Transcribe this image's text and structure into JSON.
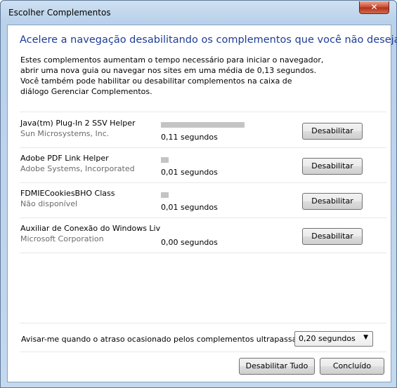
{
  "window": {
    "title": "Escolher Complementos",
    "close_glyph": "✕"
  },
  "headline": "Acelere a navegação desabilitando os complementos que você não deseja",
  "intro_lines": [
    "Estes complementos aumentam o tempo necessário para iniciar o navegador,",
    "abrir uma nova guia ou navegar nos sites em uma média de 0,13 segundos.",
    "Você também pode habilitar ou desabilitar complementos na caixa de",
    "diálogo Gerenciar Complementos."
  ],
  "addons": [
    {
      "name": "Java(tm) Plug-In 2 SSV Helper",
      "publisher": "Sun Microsystems, Inc.",
      "time": "0,11 segundos",
      "seconds": 0.11,
      "button": "Desabilitar"
    },
    {
      "name": "Adobe PDF Link Helper",
      "publisher": "Adobe Systems, Incorporated",
      "time": "0,01 segundos",
      "seconds": 0.01,
      "button": "Desabilitar"
    },
    {
      "name": "FDMIECookiesBHO Class",
      "publisher": "Não disponível",
      "time": "0,01 segundos",
      "seconds": 0.01,
      "button": "Desabilitar"
    },
    {
      "name": "Auxiliar de Conexão do Windows Liv",
      "publisher": "Microsoft Corporation",
      "time": "0,00 segundos",
      "seconds": 0.0,
      "button": "Desabilitar"
    }
  ],
  "footer": {
    "notify_label": "Avisar-me quando o atraso ocasionado pelos complementos ultrapassar:",
    "threshold_value": "0,20 segundos",
    "disable_all": "Desabilitar Tudo",
    "done": "Concluído"
  },
  "colors": {
    "headline": "#1e3c96",
    "load_bar": "#c4c4c4",
    "close_button": "#c9472b"
  }
}
